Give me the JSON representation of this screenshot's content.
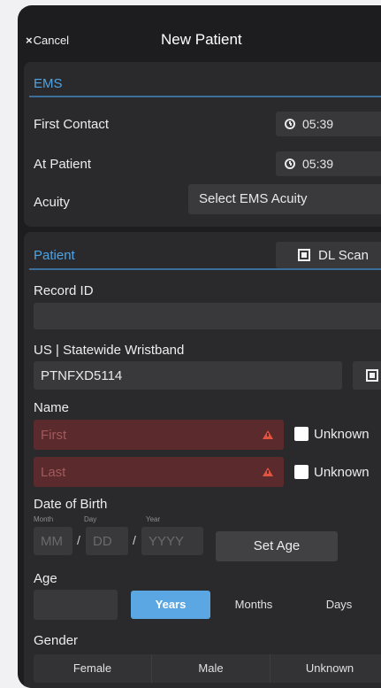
{
  "nav": {
    "cancel": "Cancel",
    "cancel_glyph": "×",
    "title": "New Patient"
  },
  "ems": {
    "header": "EMS",
    "first_contact": {
      "label": "First Contact",
      "time": "05:39"
    },
    "at_patient": {
      "label": "At Patient",
      "time": "05:39"
    },
    "acuity": {
      "label": "Acuity",
      "value": "Select EMS Acuity"
    }
  },
  "patient": {
    "header": "Patient",
    "dl_scan": "DL Scan",
    "record_id": {
      "label": "Record ID",
      "value": ""
    },
    "wristband": {
      "label": "US | Statewide Wristband",
      "value": "PTNFXD5114"
    },
    "name": {
      "label": "Name",
      "first_placeholder": "First",
      "last_placeholder": "Last",
      "unknown_label": "Unknown"
    },
    "dob": {
      "label": "Date of Birth",
      "month_caption": "Month",
      "day_caption": "Day",
      "year_caption": "Year",
      "month_placeholder": "MM",
      "day_placeholder": "DD",
      "year_placeholder": "YYYY",
      "separator": "/",
      "set_age": "Set Age"
    },
    "age": {
      "label": "Age",
      "units": [
        "Years",
        "Months",
        "Days"
      ],
      "selected": "Years"
    },
    "gender": {
      "label": "Gender",
      "options": [
        "Female",
        "Male",
        "Unknown"
      ]
    }
  },
  "colors": {
    "accent": "#4fa3e3",
    "segment_selected": "#5aa7e3",
    "error_field": "#5a2a2c",
    "warning": "#e2533f"
  }
}
